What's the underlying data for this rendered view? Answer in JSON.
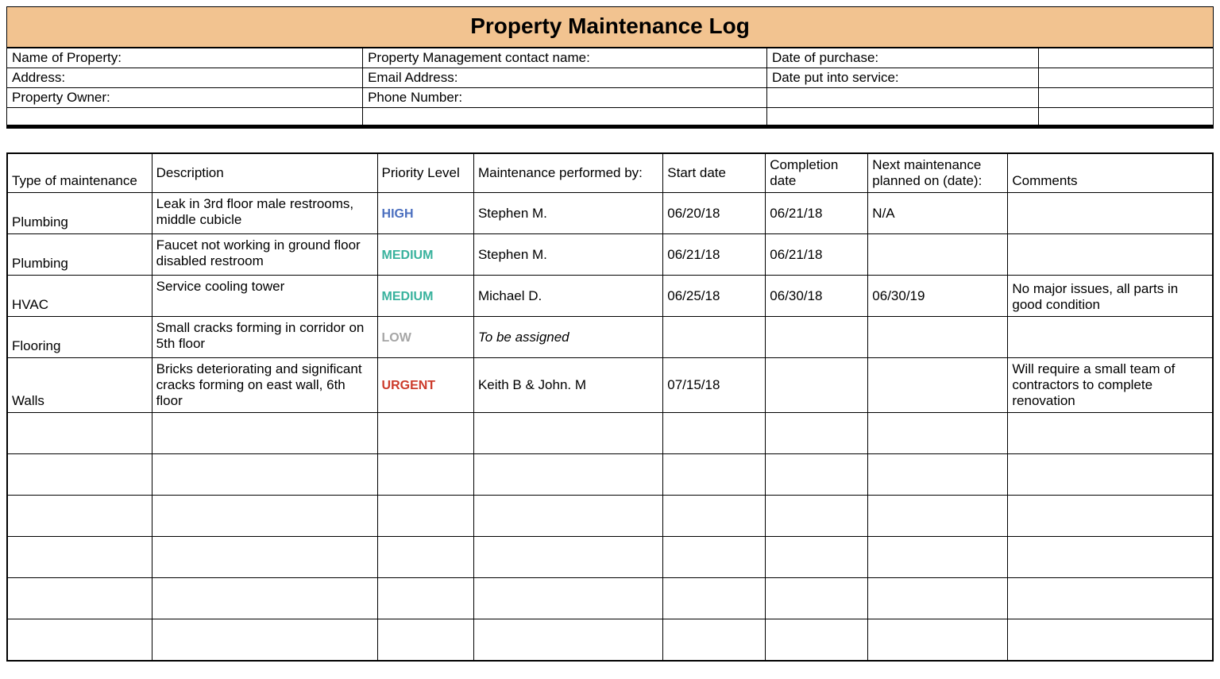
{
  "title": "Property Maintenance Log",
  "info": {
    "rows": [
      [
        "Name of Property:",
        "Property Management contact name:",
        "Date of purchase:",
        ""
      ],
      [
        "Address:",
        "Email Address:",
        "Date put into service:",
        ""
      ],
      [
        "Property Owner:",
        "Phone Number:",
        "",
        ""
      ],
      [
        "",
        "",
        "",
        ""
      ]
    ]
  },
  "log": {
    "headers": [
      "Type of maintenance",
      "Description",
      "Priority Level",
      "Maintenance performed by:",
      "Start date",
      "Completion date",
      "Next maintenance planned on (date):",
      "Comments"
    ],
    "rows": [
      {
        "type": "Plumbing",
        "desc": "Leak in 3rd floor male restrooms, middle cubicle",
        "priority": "HIGH",
        "by": "Stephen M.",
        "start": "06/20/18",
        "complete": "06/21/18",
        "next": "N/A",
        "comments": ""
      },
      {
        "type": "Plumbing",
        "desc": "Faucet not working in ground floor disabled restroom",
        "priority": "MEDIUM",
        "by": "Stephen M.",
        "start": "06/21/18",
        "complete": "06/21/18",
        "next": "",
        "comments": ""
      },
      {
        "type": "HVAC",
        "desc": "Service cooling tower",
        "priority": "MEDIUM",
        "by": "Michael D.",
        "start": "06/25/18",
        "complete": "06/30/18",
        "next": "06/30/19",
        "comments": "No major issues, all parts in good condition"
      },
      {
        "type": "Flooring",
        "desc": "Small cracks forming in corridor on 5th floor",
        "priority": "LOW",
        "by": "To be assigned",
        "by_italic": true,
        "start": "",
        "complete": "",
        "next": "",
        "comments": ""
      },
      {
        "type": "Walls",
        "desc": "Bricks deteriorating and significant cracks forming on east wall, 6th floor",
        "priority": "URGENT",
        "by": "Keith B & John. M",
        "start": "07/15/18",
        "complete": "",
        "next": "",
        "comments": "Will require a small team of contractors to complete renovation"
      },
      {
        "type": "",
        "desc": "",
        "priority": "",
        "by": "",
        "start": "",
        "complete": "",
        "next": "",
        "comments": ""
      },
      {
        "type": "",
        "desc": "",
        "priority": "",
        "by": "",
        "start": "",
        "complete": "",
        "next": "",
        "comments": ""
      },
      {
        "type": "",
        "desc": "",
        "priority": "",
        "by": "",
        "start": "",
        "complete": "",
        "next": "",
        "comments": ""
      },
      {
        "type": "",
        "desc": "",
        "priority": "",
        "by": "",
        "start": "",
        "complete": "",
        "next": "",
        "comments": ""
      },
      {
        "type": "",
        "desc": "",
        "priority": "",
        "by": "",
        "start": "",
        "complete": "",
        "next": "",
        "comments": ""
      },
      {
        "type": "",
        "desc": "",
        "priority": "",
        "by": "",
        "start": "",
        "complete": "",
        "next": "",
        "comments": ""
      }
    ]
  }
}
